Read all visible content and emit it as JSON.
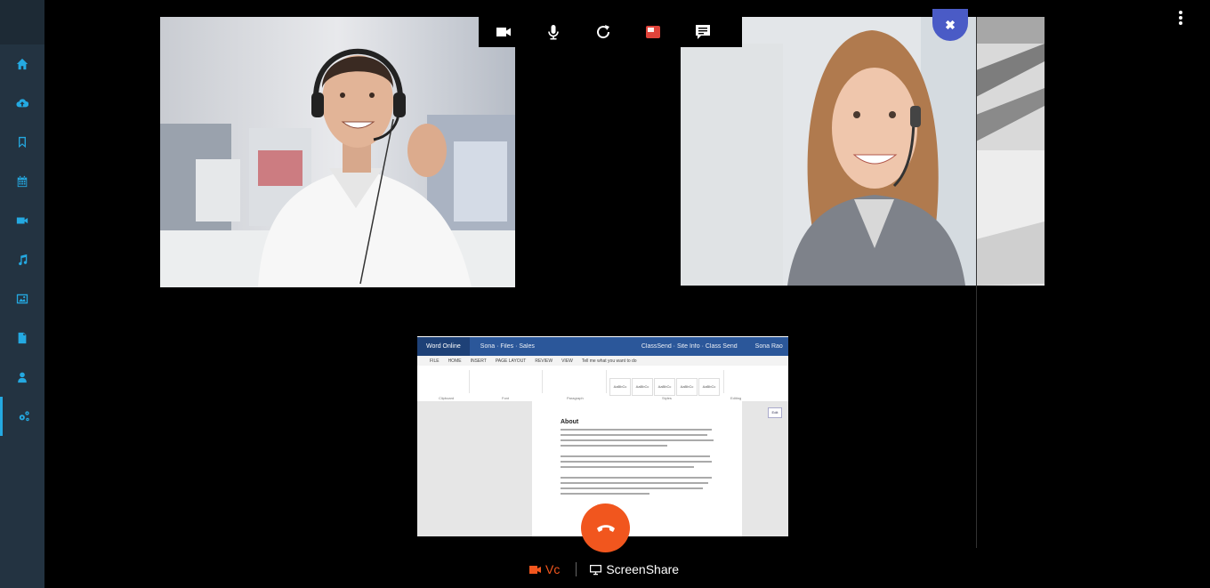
{
  "sidebar": {
    "items": [
      {
        "name": "home-icon"
      },
      {
        "name": "cloud-upload-icon"
      },
      {
        "name": "bookmark-icon"
      },
      {
        "name": "calendar-icon"
      },
      {
        "name": "video-camera-icon"
      },
      {
        "name": "music-icon"
      },
      {
        "name": "image-icon"
      },
      {
        "name": "document-icon"
      },
      {
        "name": "user-icon"
      },
      {
        "name": "settings-network-icon",
        "active": true
      }
    ],
    "accent": "#24a9e1"
  },
  "controls": [
    "camera-icon",
    "microphone-icon",
    "refresh-icon",
    "stop-share-icon",
    "chat-icon"
  ],
  "close_symbol": "✖",
  "screen_share": {
    "app_name": "Word Online",
    "breadcrumb": "Sona · Files · Sales",
    "doc_name": "ClassSend · Site Info · Class Send",
    "user": "Sona Rao",
    "tabs": [
      "FILE",
      "HOME",
      "INSERT",
      "PAGE LAYOUT",
      "REVIEW",
      "VIEW",
      "Tell me what you want to do"
    ],
    "heading": "About",
    "styles": [
      "AaBbCc",
      "AaBbCc",
      "AaBbCc",
      "AaBbCc",
      "AaBbCc"
    ],
    "groups": [
      "Clipboard",
      "Font",
      "Paragraph",
      "Styles",
      "Editing"
    ],
    "side_label": "Edit"
  },
  "bottom_tabs": {
    "vc_label": "Vc",
    "screenshare_label": "ScreenShare",
    "active_color": "#f1561e"
  },
  "hangup_color": "#f1561e"
}
